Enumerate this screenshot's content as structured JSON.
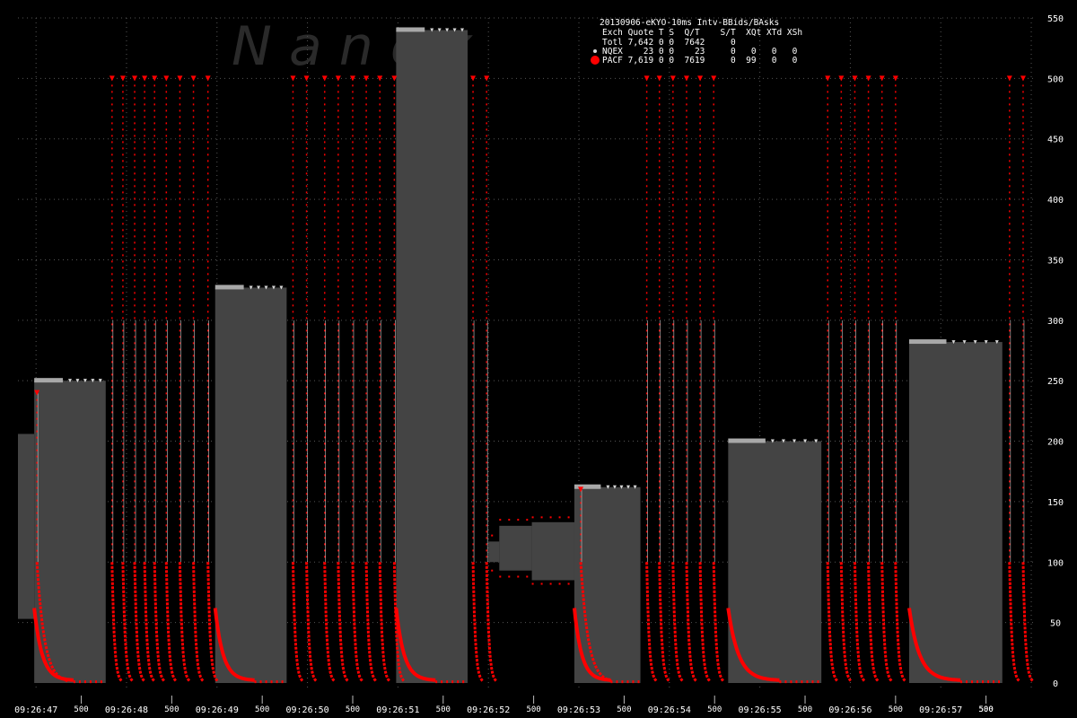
{
  "chart_data": {
    "type": "bar",
    "title": "20130906-eKYO-10ms Intv-BBids/BAsks",
    "watermark": "N  a  n  e  x",
    "yaxis": {
      "ticks": [
        0,
        50,
        100,
        150,
        200,
        250,
        300,
        350,
        400,
        450,
        500,
        550
      ],
      "ylim": [
        0,
        550
      ]
    },
    "xaxis": {
      "time_labels": [
        "09:26:47",
        "09:26:48",
        "09:26:49",
        "09:26:50",
        "09:26:51",
        "09:26:52",
        "09:26:53",
        "09:26:54",
        "09:26:55",
        "09:26:56",
        "09:26:57"
      ],
      "interval_marker": "500",
      "tlim": [
        46.8,
        57.95
      ]
    },
    "legend": {
      "header": "Exch Quote T S  Q/T    S/T  XQt XTd XSh",
      "rows": [
        {
          "text": "Totl 7,642 0 0  7642     0",
          "marker": "none"
        },
        {
          "text": "NQEX    23 0 0    23     0   0   0   0",
          "marker": "small-gray-dot"
        },
        {
          "text": "PACF 7,619 0 0  7619     0  99   0   0",
          "marker": "large-red-dot"
        }
      ]
    },
    "colors": {
      "background": "#000000",
      "bar": "#444444",
      "bar_top": "#a8a8a8",
      "pacf": "#ff0000",
      "nqex": "#d8d8d8",
      "grid": "#555555",
      "text": "#ffffff"
    },
    "series": [
      {
        "name": "NQEX",
        "kind": "best bid / best ask range",
        "segments": [
          {
            "t0": 46.8,
            "t1": 46.98,
            "bid": 53,
            "ask": 206
          },
          {
            "t0": 46.98,
            "t1": 47.77,
            "bid": 0,
            "ask": 250
          },
          {
            "t0": 48.98,
            "t1": 49.77,
            "bid": 0,
            "ask": 327
          },
          {
            "t0": 50.98,
            "t1": 51.77,
            "bid": 0,
            "ask": 540
          },
          {
            "t0": 52.0,
            "t1": 52.12,
            "bid": 100,
            "ask": 117
          },
          {
            "t0": 52.12,
            "t1": 52.48,
            "bid": 93,
            "ask": 130
          },
          {
            "t0": 52.48,
            "t1": 52.95,
            "bid": 85,
            "ask": 133
          },
          {
            "t0": 52.95,
            "t1": 53.68,
            "bid": 0,
            "ask": 162
          },
          {
            "t0": 54.65,
            "t1": 55.68,
            "bid": 0,
            "ask": 200
          },
          {
            "t0": 56.65,
            "t1": 57.68,
            "bid": 0,
            "ask": 282
          }
        ]
      },
      {
        "name": "PACF",
        "kind": "decaying quote streams",
        "bursts": [
          {
            "t": 47.01,
            "peak": 240
          },
          {
            "t": 47.84,
            "peak": 500
          },
          {
            "t": 47.96,
            "peak": 500
          },
          {
            "t": 48.09,
            "peak": 500
          },
          {
            "t": 48.2,
            "peak": 500
          },
          {
            "t": 48.31,
            "peak": 500
          },
          {
            "t": 48.44,
            "peak": 500
          },
          {
            "t": 48.59,
            "peak": 500
          },
          {
            "t": 48.74,
            "peak": 500
          },
          {
            "t": 48.9,
            "peak": 500
          },
          {
            "t": 49.84,
            "peak": 500
          },
          {
            "t": 49.99,
            "peak": 500
          },
          {
            "t": 50.19,
            "peak": 500
          },
          {
            "t": 50.34,
            "peak": 500
          },
          {
            "t": 50.5,
            "peak": 500
          },
          {
            "t": 50.65,
            "peak": 500
          },
          {
            "t": 50.8,
            "peak": 500
          },
          {
            "t": 50.96,
            "peak": 500
          },
          {
            "t": 51.83,
            "peak": 500
          },
          {
            "t": 51.98,
            "peak": 500
          },
          {
            "t": 53.02,
            "peak": 160
          },
          {
            "t": 53.75,
            "peak": 500
          },
          {
            "t": 53.89,
            "peak": 500
          },
          {
            "t": 54.04,
            "peak": 500
          },
          {
            "t": 54.19,
            "peak": 500
          },
          {
            "t": 54.34,
            "peak": 500
          },
          {
            "t": 54.49,
            "peak": 500
          },
          {
            "t": 55.75,
            "peak": 500
          },
          {
            "t": 55.9,
            "peak": 500
          },
          {
            "t": 56.05,
            "peak": 500
          },
          {
            "t": 56.2,
            "peak": 500
          },
          {
            "t": 56.35,
            "peak": 500
          },
          {
            "t": 56.5,
            "peak": 500
          },
          {
            "t": 57.76,
            "peak": 500
          },
          {
            "t": 57.91,
            "peak": 500
          }
        ],
        "flat_asks": [
          {
            "t0": 52.03,
            "t1": 52.12,
            "v": 122
          },
          {
            "t0": 52.12,
            "t1": 52.48,
            "v": 135
          },
          {
            "t0": 52.48,
            "t1": 52.95,
            "v": 137
          }
        ],
        "flat_bids": [
          {
            "t0": 52.03,
            "t1": 52.12,
            "v": 93
          },
          {
            "t0": 52.12,
            "t1": 52.48,
            "v": 88
          },
          {
            "t0": 52.48,
            "t1": 52.95,
            "v": 82
          }
        ]
      }
    ]
  }
}
